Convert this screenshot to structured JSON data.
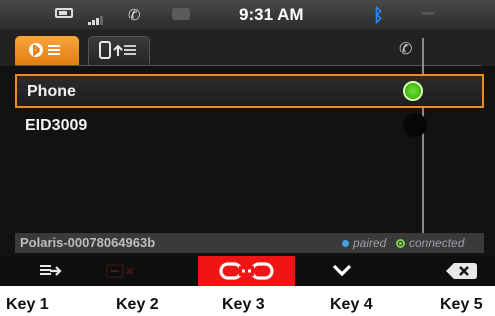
{
  "status_bar": {
    "time": "9:31 AM",
    "icons": [
      "battery-icon",
      "signal-icon",
      "phone-icon",
      "message-icon",
      "bluetooth-icon"
    ]
  },
  "tabs": [
    {
      "name": "bluetooth-devices",
      "icon": "bluetooth-list-icon",
      "active": true
    },
    {
      "name": "phone-transfer",
      "icon": "phone-transfer-icon",
      "active": false
    }
  ],
  "list_header_icon": "phone-icon",
  "devices": [
    {
      "label": "Phone",
      "selected": true,
      "connected": true
    },
    {
      "label": "EID3009",
      "selected": false,
      "connected": false
    }
  ],
  "device_bar": {
    "name": "Polaris-00078064963b",
    "legend_paired": "paired",
    "legend_connected": "connected"
  },
  "softkeys": [
    {
      "icon": "transfer-arrow-icon"
    },
    {
      "icon": "delete-disabled-icon"
    },
    {
      "icon": "disconnect-icon"
    },
    {
      "icon": "chevron-down-icon"
    },
    {
      "icon": "backspace-icon"
    }
  ],
  "key_labels": [
    "Key 1",
    "Key 2",
    "Key 3",
    "Key 4",
    "Key 5"
  ],
  "colors": {
    "accent": "#f08a1c",
    "selected_key": "#f01515",
    "connected": "#5fd12a",
    "paired": "#3fa4e8"
  }
}
